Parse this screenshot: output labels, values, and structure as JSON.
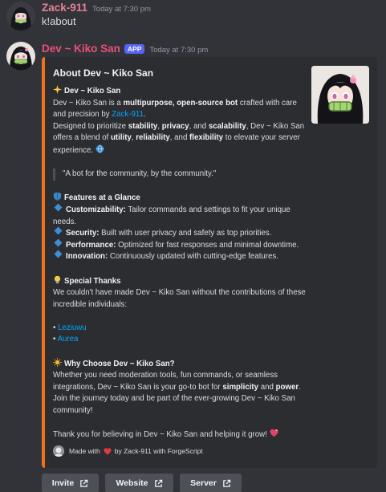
{
  "message1": {
    "username": "Zack-911",
    "username_color": "#e5809a",
    "timestamp": "Today at 7:30 pm",
    "content": "k!about"
  },
  "message2": {
    "username": "Dev ~ Kiko San",
    "username_color": "#ea4f7a",
    "app_badge": "APP",
    "timestamp": "Today at 7:30 pm"
  },
  "embed": {
    "accent_color": "#f0701b",
    "title": "About Dev ~ Kiko San",
    "intro_heading": "Dev ~ Kiko San",
    "intro_pre": "Dev ~ Kiko San is a ",
    "intro_bold1": "multipurpose, open-source bot",
    "intro_mid": " crafted with care and precision by ",
    "intro_link": "Zack-911",
    "intro_end": ".",
    "design_pre": "Designed to prioritize ",
    "design_b1": "stability",
    "design_sep1": ", ",
    "design_b2": "privacy",
    "design_sep2": ", and ",
    "design_b3": "scalability",
    "design_mid": ", Dev ~ Kiko San offers a blend of ",
    "design_b4": "utility",
    "design_sep3": ", ",
    "design_b5": "reliability",
    "design_sep4": ", and ",
    "design_b6": "flexibility",
    "design_end": " to elevate your server experience.",
    "quote": "\"A bot for the community, by the community.\"",
    "features_heading": "Features at a Glance",
    "features": [
      {
        "name": "Customizability:",
        "text": " Tailor commands and settings to fit your unique needs."
      },
      {
        "name": "Security:",
        "text": " Built with user privacy and safety as top priorities."
      },
      {
        "name": "Performance:",
        "text": " Optimized for fast responses and minimal downtime."
      },
      {
        "name": "Innovation:",
        "text": " Continuously updated with cutting-edge features."
      }
    ],
    "thanks_heading": "Special Thanks",
    "thanks_text": "We couldn't have made Dev ~ Kiko San without the contributions of these incredible individuals:",
    "thanks_people": [
      "Leziuwu",
      "Aurea"
    ],
    "why_heading": "Why Choose Dev ~ Kiko San?",
    "why_pre": "Whether you need moderation tools, fun commands, or seamless integrations, Dev ~ Kiko San is your go-to bot for ",
    "why_b1": "simplicity",
    "why_and": " and ",
    "why_b2": "power",
    "why_end": ". Join the journey today and be part of the ever-growing Dev ~ Kiko San community!",
    "closing": "Thank you for believing in Dev ~ Kiko San and helping it grow!",
    "footer_pre": "Made with",
    "footer_post": "by Zack-911 with ForgeScript"
  },
  "buttons": [
    {
      "label": "Invite"
    },
    {
      "label": "Website"
    },
    {
      "label": "Server"
    }
  ]
}
